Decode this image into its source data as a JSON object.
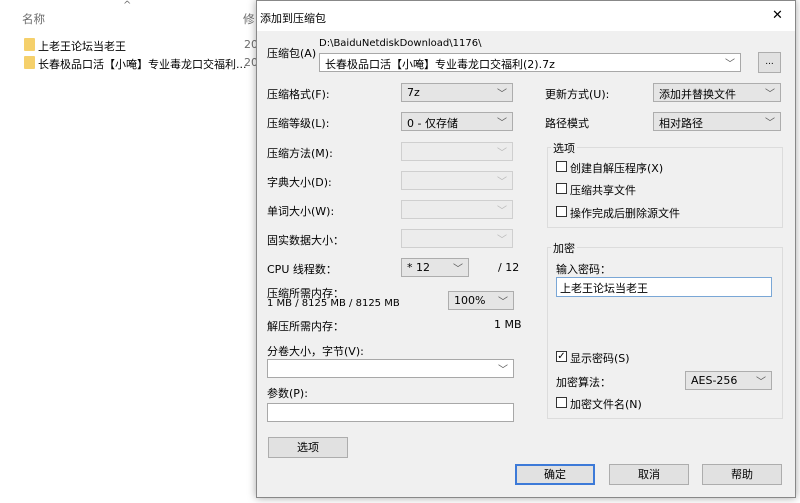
{
  "explorer": {
    "col_name": "名称",
    "col_modified": "修",
    "sort_icon": "caret-up",
    "rows": [
      {
        "name": "上老王论坛当老王",
        "date": "20"
      },
      {
        "name": "长春极品口活【小唵】专业毒龙口交福利...",
        "date": "20"
      }
    ]
  },
  "dialog": {
    "title": "添加到压缩包",
    "close": "✕",
    "archive_label": "压缩包(A)",
    "archive_path": "D:\\BaiduNetdiskDownload\\1176\\",
    "archive_name": "长春极品口活【小唵】专业毒龙口交福利(2).7z",
    "browse": "...",
    "format_label": "压缩格式(F):",
    "format": "7z",
    "level_label": "压缩等级(L):",
    "level": "0 - 仅存储",
    "method_label": "压缩方法(M):",
    "dict_label": "字典大小(D):",
    "word_label": "单词大小(W):",
    "solid_label": "固实数据大小：",
    "cpu_label": "CPU 线程数：",
    "cpu": "* 12",
    "cpu_max": "/ 12",
    "mem_label": "压缩所需内存：",
    "mem_values": "1 MB / 8125 MB / 8125 MB",
    "mem_pct": "100%",
    "decomp_label": "解压所需内存：",
    "decomp_value": "1 MB",
    "split_label": "分卷大小，字节(V):",
    "split_value": "",
    "params_label": "参数(P):",
    "params_value": "",
    "options_button": "选项",
    "update_label": "更新方式(U):",
    "update": "添加并替换文件",
    "path_label": "路径模式",
    "path": "相对路径",
    "options_group": "选项",
    "opt_sfx": "创建自解压程序(X)",
    "opt_shared": "压缩共享文件",
    "opt_delete": "操作完成后删除源文件",
    "enc_group": "加密",
    "pwd_label": "输入密码：",
    "pwd_value": "上老王论坛当老王",
    "show_pwd": "显示密码(S)",
    "show_pwd_checked": true,
    "algo_label": "加密算法：",
    "algo": "AES-256",
    "enc_names": "加密文件名(N)",
    "ok": "确定",
    "cancel": "取消",
    "help": "帮助"
  }
}
